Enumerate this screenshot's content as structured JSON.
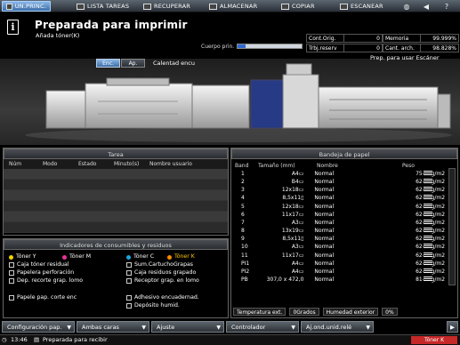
{
  "tabs": [
    {
      "label": "UN.PRINC."
    },
    {
      "label": "LISTA TAREAS"
    },
    {
      "label": "RECUPERAR"
    },
    {
      "label": "ALMACENAR"
    },
    {
      "label": "COPIAR"
    },
    {
      "label": "ESCANEAR"
    }
  ],
  "header": {
    "title": "Preparada para imprimir",
    "subtitle": "Añada tóner(K)",
    "cuerpo_label": "Cuerpo prin.",
    "cuerpo_fill": 0.12
  },
  "counters": [
    {
      "label": "Cont.Orig.",
      "value": "0",
      "label2": "Memoria",
      "value2": "99.999%"
    },
    {
      "label": "Trbj.reserv",
      "value": "0",
      "label2": "Cant. arch.",
      "value2": "98.828%"
    }
  ],
  "machine": {
    "mode_on": "Enc.",
    "mode_off": "Ap.",
    "calentando": "Calentad encu",
    "prep": "Prep. para usar Escáner"
  },
  "tarea": {
    "title": "Tarea",
    "columns": [
      "Núm",
      "Modo",
      "Estado",
      "Minuto(s)",
      "Nombre usuario"
    ]
  },
  "indicadores": {
    "title": "Indicadores de consumibles y residuos",
    "toners": [
      "Tóner Y",
      "Tóner M",
      "Tóner C",
      "Tóner K"
    ],
    "toner_colors": [
      "#f2d400",
      "#e8339a",
      "#1aa5e0",
      "#ffcc00"
    ],
    "items": [
      "Caja tóner residual",
      "Sum.CartuchoGrapas",
      "Papelera perforación",
      "Caja residuos grapado",
      "Dep. recorte grap. lomo",
      "Receptor grap. en lomo",
      "Papele pap. corte enc",
      "Adhesivo encuadernad.",
      "Depósito humid."
    ]
  },
  "bandeja": {
    "title": "Bandeja de papel",
    "columns": [
      "Band",
      "Tamaño (mm)",
      "Nombre",
      "Peso"
    ],
    "rows": [
      {
        "band": "1",
        "size": "A4▭",
        "name": "Normal",
        "peso": "75-80g/m2"
      },
      {
        "band": "2",
        "size": "B4▭",
        "name": "Normal",
        "peso": "62-74g/m2"
      },
      {
        "band": "3",
        "size": "12x18▭",
        "name": "Normal",
        "peso": "62-74g/m2"
      },
      {
        "band": "4",
        "size": "8,5x11▯",
        "name": "Normal",
        "peso": "62-74g/m2"
      },
      {
        "band": "5",
        "size": "12x18▭",
        "name": "Normal",
        "peso": "62-74g/m2"
      },
      {
        "band": "6",
        "size": "11x17▭",
        "name": "Normal",
        "peso": "62-74g/m2"
      },
      {
        "band": "7",
        "size": "A3▭",
        "name": "Normal",
        "peso": "62-74g/m2"
      },
      {
        "band": "8",
        "size": "13x19▭",
        "name": "Normal",
        "peso": "62-74g/m2"
      },
      {
        "band": "9",
        "size": "8,5x11▯",
        "name": "Normal",
        "peso": "62-74g/m2"
      },
      {
        "band": "10",
        "size": "A3▭",
        "name": "Normal",
        "peso": "62-74g/m2"
      },
      {
        "band": "11",
        "size": "11x17▭",
        "name": "Normal",
        "peso": "62-74g/m2"
      },
      {
        "band": "PI1",
        "size": "A4▭",
        "name": "Normal",
        "peso": "62-74g/m2"
      },
      {
        "band": "PI2",
        "size": "A4▭",
        "name": "Normal",
        "peso": "62-74g/m2"
      },
      {
        "band": "PB",
        "size": "307,0 x 472,0",
        "name": "Normal",
        "peso": "81-91g/m2"
      }
    ],
    "temp_label": "Temperatura ext.",
    "temp_value": "0Grados",
    "hum_label": "Humedad exterior",
    "hum_value": "0%"
  },
  "bottom": [
    {
      "label": "Configuración pap."
    },
    {
      "label": "Ambas caras"
    },
    {
      "label": "Ajuste"
    },
    {
      "label": "Controlador"
    },
    {
      "label": "Aj.ond.unid.relé"
    }
  ],
  "status": {
    "time": "13:46",
    "text": "Preparada para recibir",
    "toner_alert": "Tóner K"
  }
}
